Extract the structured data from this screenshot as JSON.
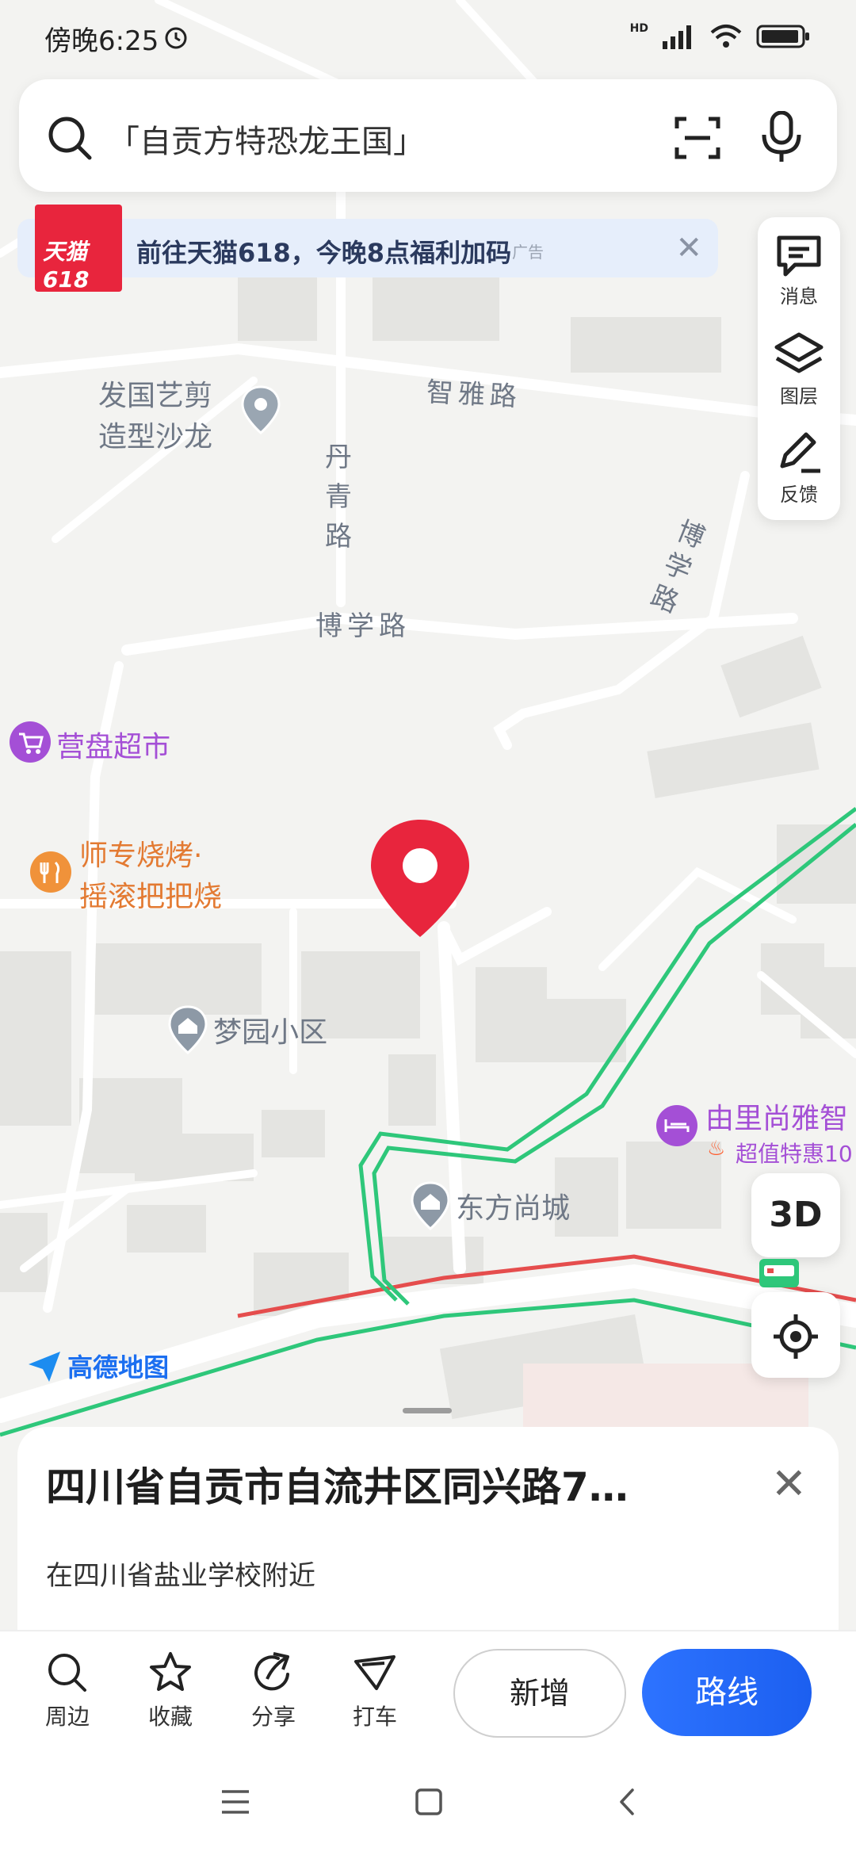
{
  "status_bar": {
    "time": "傍晚6:25",
    "network": "HD"
  },
  "search": {
    "placeholder": "「自贡方特恐龙王国」"
  },
  "ad": {
    "logo_text": "天猫618",
    "title": "前往天猫618，今晚8点福利加码",
    "tag": "广告"
  },
  "tools": [
    {
      "label": "消息",
      "icon": "message-icon"
    },
    {
      "label": "图层",
      "icon": "layers-icon"
    },
    {
      "label": "反馈",
      "icon": "feedback-icon"
    }
  ],
  "map": {
    "roads": {
      "zhiya": "智雅路",
      "danqing": "丹青路",
      "boxue1": "博学路",
      "boxue2": "博学路"
    },
    "pois": {
      "salon": "发国艺剪造型沙龙",
      "salon_line1": "发国艺剪",
      "salon_line2": "造型沙龙",
      "market": "营盘超市",
      "bbq_line1": "师专烧烤·",
      "bbq_line2": "摇滚把把烧",
      "mengyuan": "梦园小区",
      "dongfang": "东方尚城",
      "hotel": "由里尚雅智",
      "hotel_promo": "超值特惠10"
    },
    "logo": "高德地图",
    "btn_3d": "3D"
  },
  "card": {
    "title": "四川省自贡市自流井区同兴路7…",
    "subtitle": "在四川省盐业学校附近"
  },
  "actions": {
    "nearby": "周边",
    "favorite": "收藏",
    "share": "分享",
    "taxi": "打车",
    "new": "新增",
    "route": "路线"
  },
  "colors": {
    "accent": "#1c5ff0",
    "pin": "#e8253d",
    "route_green": "#2ec77a",
    "route_red": "#e54d4d"
  }
}
